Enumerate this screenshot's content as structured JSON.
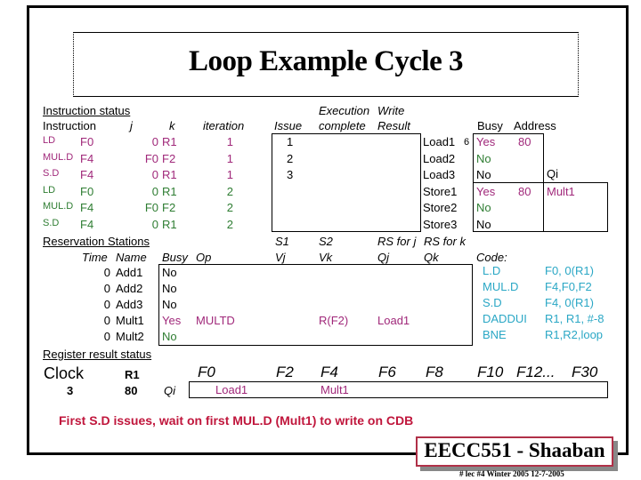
{
  "title": "Loop Example Cycle 3",
  "instruction_status": {
    "heading": "Instruction status",
    "headers": {
      "instruction": "Instruction",
      "j": "j",
      "k": "k",
      "iteration": "iteration",
      "issue": "Issue",
      "exec_top": "Execution",
      "exec_bottom": "complete",
      "write_top": "Write",
      "write_bottom": "Result"
    },
    "rows": [
      {
        "op": "LD",
        "dest": "F0",
        "j": "0",
        "k": "R1",
        "iteration": "1",
        "issue": "1",
        "exec": "",
        "write": ""
      },
      {
        "op": "MUL.D",
        "dest": "F4",
        "j": "F0",
        "k": "F2",
        "iteration": "1",
        "issue": "2",
        "exec": "",
        "write": ""
      },
      {
        "op": "S.D",
        "dest": "F4",
        "j": "0",
        "k": "R1",
        "iteration": "1",
        "issue": "3",
        "exec": "",
        "write": ""
      },
      {
        "op": "LD",
        "dest": "F0",
        "j": "0",
        "k": "R1",
        "iteration": "2",
        "issue": "",
        "exec": "",
        "write": ""
      },
      {
        "op": "MUL.D",
        "dest": "F4",
        "j": "F0",
        "k": "F2",
        "iteration": "2",
        "issue": "",
        "exec": "",
        "write": ""
      },
      {
        "op": "S.D",
        "dest": "F4",
        "j": "0",
        "k": "R1",
        "iteration": "2",
        "issue": "",
        "exec": "",
        "write": ""
      }
    ],
    "iteration_colors": {
      "1": "#a0287a",
      "2": "#2e7d32"
    }
  },
  "load_store_buffers": {
    "headers": {
      "busy": "Busy",
      "address": "Address",
      "qi": "Qi"
    },
    "load1_time": "6",
    "rows": [
      {
        "name": "Load1",
        "busy": "Yes",
        "address": "80",
        "qi": null
      },
      {
        "name": "Load2",
        "busy": "No",
        "address": "",
        "qi": null
      },
      {
        "name": "Load3",
        "busy": "No",
        "address": "",
        "qi": null
      },
      {
        "name": "Store1",
        "busy": "Yes",
        "address": "80",
        "qi": "Mult1"
      },
      {
        "name": "Store2",
        "busy": "No",
        "address": "",
        "qi": ""
      },
      {
        "name": "Store3",
        "busy": "No",
        "address": "",
        "qi": ""
      }
    ]
  },
  "reservation_stations": {
    "heading": "Reservation Stations",
    "headers": {
      "time": "Time",
      "name": "Name",
      "busy": "Busy",
      "op": "Op",
      "s1": "S1",
      "vj": "Vj",
      "s2": "S2",
      "vk": "Vk",
      "rsj": "RS for j",
      "qj": "Qj",
      "rsk": "RS for k",
      "qk": "Qk"
    },
    "rows": [
      {
        "time": "0",
        "name": "Add1",
        "busy": "No",
        "op": "",
        "vj": "",
        "vk": "",
        "qj": "",
        "qk": ""
      },
      {
        "time": "0",
        "name": "Add2",
        "busy": "No",
        "op": "",
        "vj": "",
        "vk": "",
        "qj": "",
        "qk": ""
      },
      {
        "time": "0",
        "name": "Add3",
        "busy": "No",
        "op": "",
        "vj": "",
        "vk": "",
        "qj": "",
        "qk": ""
      },
      {
        "time": "0",
        "name": "Mult1",
        "busy": "Yes",
        "op": "MULTD",
        "vj": "",
        "vk": "R(F2)",
        "qj": "Load1",
        "qk": ""
      },
      {
        "time": "0",
        "name": "Mult2",
        "busy": "No",
        "op": "",
        "vj": "",
        "vk": "",
        "qj": "",
        "qk": ""
      }
    ]
  },
  "code": {
    "heading": "Code:",
    "lines": [
      {
        "op": "L.D",
        "args": "F0, 0(R1)"
      },
      {
        "op": "MUL.D",
        "args": "F4,F0,F2"
      },
      {
        "op": "S.D",
        "args": "F4, 0(R1)"
      },
      {
        "op": "DADDUI",
        "args": "R1, R1, #-8"
      },
      {
        "op": "BNE",
        "args": "R1,R2,loop"
      }
    ]
  },
  "register_status": {
    "heading": "Register result status",
    "clock_label": "Clock",
    "clock_value": "3",
    "r1_label": "R1",
    "r1_value": "80",
    "qi_label": "Qi",
    "registers": [
      "F0",
      "F2",
      "F4",
      "F6",
      "F8",
      "F10",
      "F12...",
      "F30"
    ],
    "qi": {
      "F0": "Load1",
      "F4": "Mult1"
    }
  },
  "note": "First  S.D  issues,  wait on first MUL.D  (Mult1) to write on CDB",
  "badge": "EECC551 - Shaaban",
  "footer": "#  lec #4  Winter 2005    12-7-2005"
}
